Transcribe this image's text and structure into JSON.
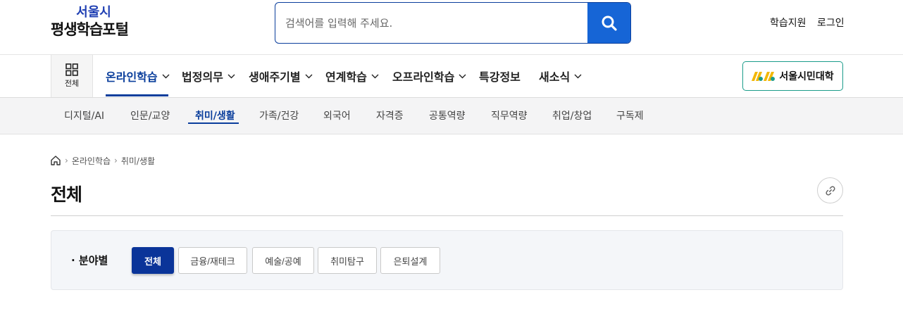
{
  "header": {
    "logo_top": "서울시",
    "logo_bottom": "평생학습포털",
    "search": {
      "placeholder": "검색어를 입력해 주세요."
    },
    "util_links": [
      "학습지원",
      "로그인"
    ]
  },
  "gnb": {
    "all_label": "전체",
    "items": [
      {
        "label": "온라인학습",
        "has_dropdown": true,
        "active": true
      },
      {
        "label": "법정의무",
        "has_dropdown": true
      },
      {
        "label": "생애주기별",
        "has_dropdown": true
      },
      {
        "label": "연계학습",
        "has_dropdown": true
      },
      {
        "label": "오프라인학습",
        "has_dropdown": true
      },
      {
        "label": "특강정보",
        "has_dropdown": false
      },
      {
        "label": "새소식",
        "has_dropdown": true
      }
    ],
    "university_button": "서울시민대학"
  },
  "subnav": {
    "items": [
      "디지털/AI",
      "인문/교양",
      "취미/생활",
      "가족/건강",
      "외국어",
      "자격증",
      "공통역량",
      "직무역량",
      "취업/창업",
      "구독제"
    ],
    "active": "취미/생활"
  },
  "breadcrumb": [
    "온라인학습",
    "취미/생활"
  ],
  "page_title": "전체",
  "filter": {
    "label": "· 분야별",
    "chips": [
      "전체",
      "금융/재테크",
      "예술/공예",
      "취미탐구",
      "은퇴설계"
    ],
    "active": "전체"
  },
  "colors": {
    "brand_blue": "#0a3e9c",
    "search_button": "#1665d6",
    "active_chip": "#0a3499",
    "university_border": "#1b9c8a"
  }
}
